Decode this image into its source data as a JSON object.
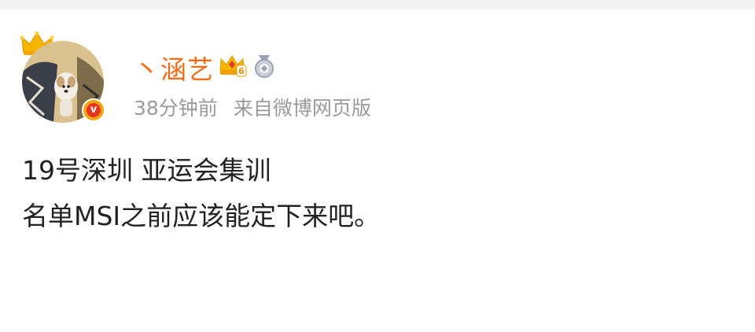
{
  "post": {
    "username": "丶涵艺",
    "time": "38分钟前",
    "source": "来自微博网页版",
    "content_lines": [
      "19号深圳 亚运会集训",
      "名单MSI之前应该能定下来吧。"
    ]
  },
  "badges": {
    "level_badge_number": "6",
    "verified_mark": "v"
  },
  "icons": {
    "crown": "crown-icon",
    "level": "crown-level-badge-icon",
    "medal": "medal-badge-icon",
    "verified": "verified-icon"
  },
  "colors": {
    "username": "#f26d1b",
    "meta": "#9a9a9a",
    "content": "#222222",
    "topbar": "#f2f2f2",
    "verified_badge": "#e8351f"
  }
}
